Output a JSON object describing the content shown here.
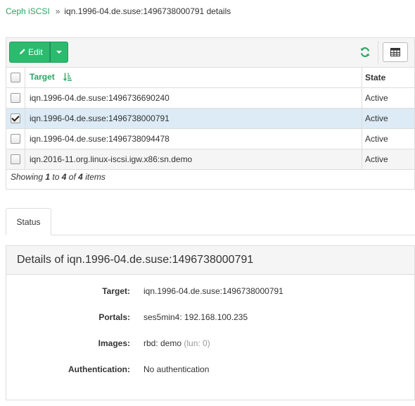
{
  "breadcrumb": {
    "root": "Ceph iSCSI",
    "separator": "»",
    "current": "iqn.1996-04.de.suse:1496738000791 details"
  },
  "toolbar": {
    "edit_label": "Edit",
    "edit_icon": "pencil-icon",
    "refresh_icon": "refresh-icon",
    "columns_icon": "table-columns-icon"
  },
  "table": {
    "columns": [
      "Target",
      "State"
    ],
    "rows": [
      {
        "target": "iqn.1996-04.de.suse:1496736690240",
        "state": "Active",
        "checked": false
      },
      {
        "target": "iqn.1996-04.de.suse:1496738000791",
        "state": "Active",
        "checked": true
      },
      {
        "target": "iqn.1996-04.de.suse:1496738094478",
        "state": "Active",
        "checked": false
      },
      {
        "target": "iqn.2016-11.org.linux-iscsi.igw.x86:sn.demo",
        "state": "Active",
        "checked": false
      }
    ],
    "footer": {
      "prefix": "Showing",
      "from": "1",
      "to_word": "to",
      "to": "4",
      "of_word": "of",
      "total": "4",
      "suffix": "items"
    }
  },
  "tabs": [
    {
      "label": "Status",
      "active": true
    }
  ],
  "details": {
    "title": "Details of iqn.1996-04.de.suse:1496738000791",
    "fields": {
      "target_label": "Target:",
      "target_value": "iqn.1996-04.de.suse:1496738000791",
      "portals_label": "Portals:",
      "portals_value": "ses5min4: 192.168.100.235",
      "images_label": "Images:",
      "images_value": "rbd: demo",
      "images_lun": "(lun: 0)",
      "auth_label": "Authentication:",
      "auth_value": "No authentication"
    }
  },
  "colors": {
    "accent": "#2ca463",
    "button": "#2bbb6e",
    "selected_row": "#dcebf5"
  }
}
